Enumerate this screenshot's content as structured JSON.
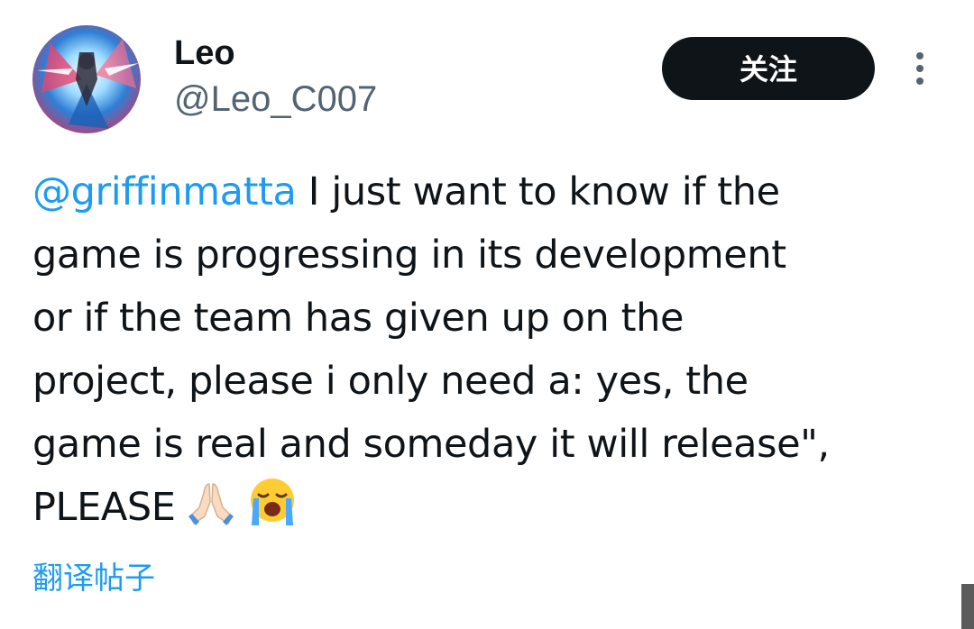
{
  "author": {
    "display_name": "Leo",
    "handle": "@Leo_C007"
  },
  "actions": {
    "follow_label": "关注",
    "more_icon": "more-vertical-icon"
  },
  "tweet": {
    "mention": "@griffinmatta",
    "lines": [
      " I just want to know if the",
      "game is progressing in its development",
      "or if the team has given up on the",
      "project, please i only need a: yes, the",
      "game is real and someday it will release\",",
      "PLEASE"
    ],
    "emojis": [
      "folded-hands-emoji",
      "loudly-crying-face-emoji"
    ]
  },
  "translate_label": "翻译帖子",
  "colors": {
    "text": "#0f1419",
    "secondary": "#536471",
    "link": "#1d9bf0",
    "button_bg": "#0f1419",
    "button_text": "#ffffff"
  }
}
